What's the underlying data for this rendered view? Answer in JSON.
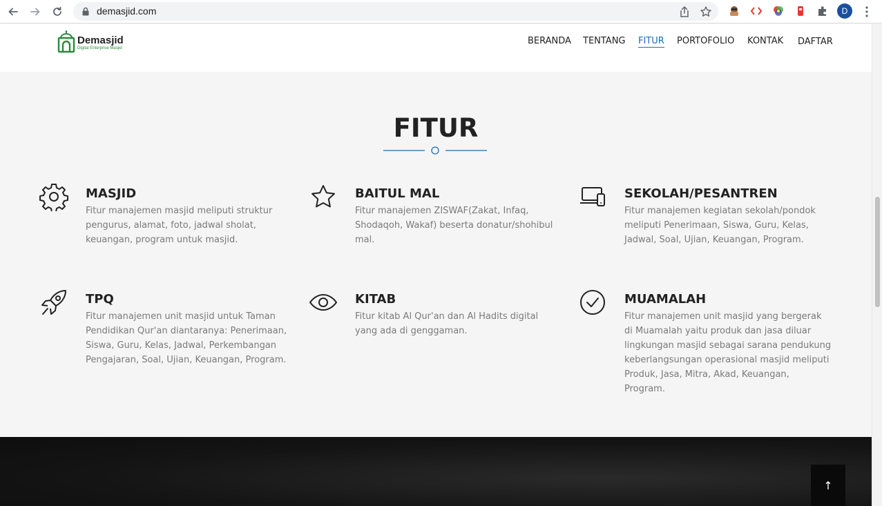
{
  "browser": {
    "url": "demasjid.com",
    "avatar_letter": "D"
  },
  "site": {
    "logo_name": "Demasjid",
    "logo_tagline": "Digital Enterprise Masjid",
    "brand_green": "#2a8a3b",
    "accent": "#1f6bb3",
    "nav": [
      "BERANDA",
      "TENTANG",
      "FITUR",
      "PORTOFOLIO",
      "KONTAK",
      "DAFTAR"
    ],
    "active_nav": "FITUR"
  },
  "section": {
    "title": "FITUR",
    "features": [
      {
        "icon": "gear-icon",
        "title": "MASJID",
        "desc": "Fitur manajemen masjid meliputi struktur pengurus, alamat, foto, jadwal sholat, keuangan, program untuk masjid."
      },
      {
        "icon": "star-icon",
        "title": "BAITUL MAL",
        "desc": "Fitur manajemen ZISWAF(Zakat, Infaq, Shodaqoh, Wakaf) beserta donatur/shohibul mal."
      },
      {
        "icon": "devices-icon",
        "title": "SEKOLAH/PESANTREN",
        "desc": "Fitur manajemen kegiatan sekolah/pondok meliputi Penerimaan, Siswa, Guru, Kelas, Jadwal, Soal, Ujian, Keuangan, Program."
      },
      {
        "icon": "rocket-icon",
        "title": "TPQ",
        "desc": "Fitur manajemen unit masjid untuk Taman Pendidikan Qur'an diantaranya: Penerimaan, Siswa, Guru, Kelas, Jadwal, Perkembangan Pengajaran, Soal, Ujian, Keuangan, Program."
      },
      {
        "icon": "eye-icon",
        "title": "KITAB",
        "desc": "Fitur kitab Al Qur'an dan Al Hadits digital yang ada di genggaman."
      },
      {
        "icon": "check-circle-icon",
        "title": "MUAMALAH",
        "desc": "Fitur manajemen unit masjid yang bergerak di Muamalah yaitu produk dan jasa diluar lingkungan masjid sebagai sarana pendukung keberlangsungan operasional masjid meliputi Produk, Jasa, Mitra, Akad, Keuangan, Program."
      }
    ]
  },
  "back_to_top": "↑"
}
